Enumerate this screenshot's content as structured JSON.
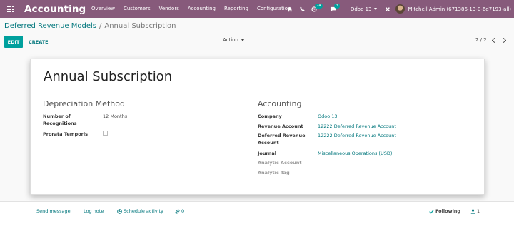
{
  "navbar": {
    "app_name": "Accounting",
    "menu": [
      "Overview",
      "Customers",
      "Vendors",
      "Accounting",
      "Reporting",
      "Configuration"
    ],
    "activity_count": "24",
    "messages_count": "3",
    "company": "Odoo 13",
    "user": "Mitchell Admin (671386-13-0-6d7193-all)"
  },
  "breadcrumb": {
    "parent": "Deferred Revenue Models",
    "separator": "/",
    "current": "Annual Subscription"
  },
  "controls": {
    "edit_label": "EDIT",
    "create_label": "CREATE",
    "action_label": "Action",
    "pager": "2 / 2"
  },
  "form": {
    "title": "Annual Subscription",
    "depreciation": {
      "heading": "Depreciation Method",
      "recognitions_label_1": "Number of",
      "recognitions_label_2": "Recognitions",
      "recognitions_value": "12 Months",
      "prorata_label": "Prorata Temporis",
      "prorata_checked": false
    },
    "accounting": {
      "heading": "Accounting",
      "company_label": "Company",
      "company_value": "Odoo 13",
      "revenue_label": "Revenue Account",
      "revenue_value": "12222 Deferred Revenue Account",
      "deferred_label_1": "Deferred Revenue",
      "deferred_label_2": "Account",
      "deferred_value": "12222 Deferred Revenue Account",
      "journal_label": "Journal",
      "journal_value": "Miscellaneous Operations (USD)",
      "analytic_account_label": "Analytic Account",
      "analytic_tag_label": "Analytic Tag"
    }
  },
  "chatter": {
    "send_message": "Send message",
    "log_note": "Log note",
    "schedule_activity": "Schedule activity",
    "attachments": "0",
    "following": "Following",
    "followers": "1"
  },
  "colors": {
    "navbar": "#875a7b",
    "primary": "#00a09d",
    "link": "#00767c"
  }
}
